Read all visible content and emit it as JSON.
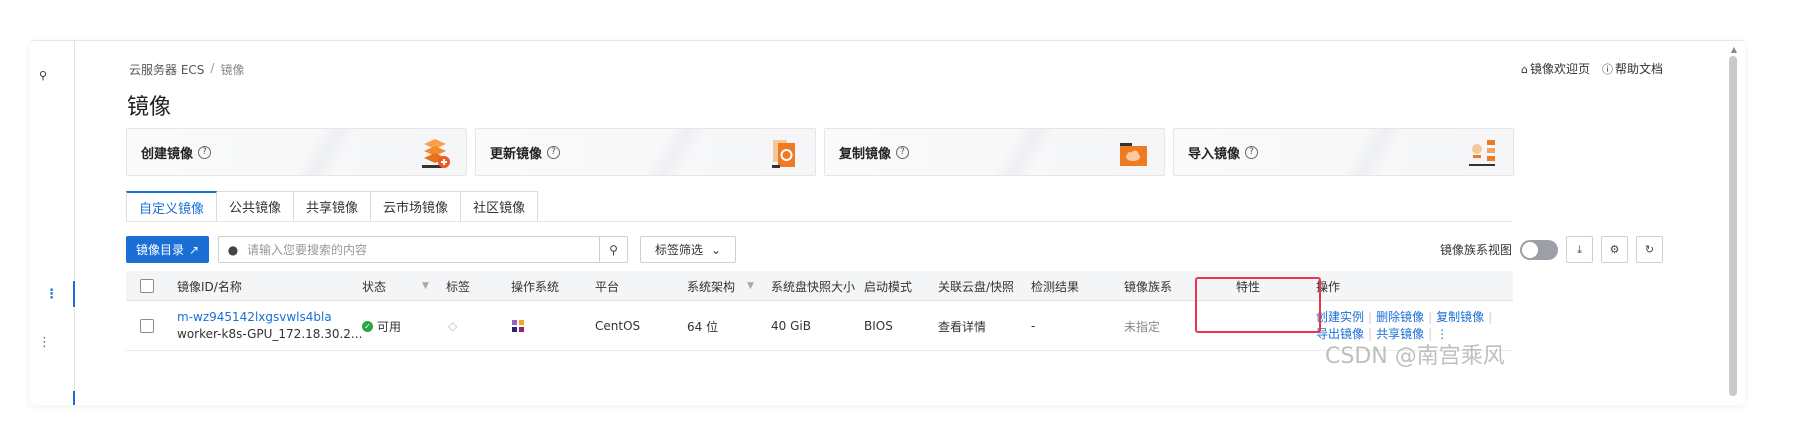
{
  "breadcrumb": {
    "root": "云服务器 ECS",
    "separator": "/",
    "current": "镜像"
  },
  "top_links": {
    "welcome": "镜像欢迎页",
    "help": "帮助文档"
  },
  "page_title": "镜像",
  "cards": [
    {
      "label": "创建镜像",
      "icon": "layers-plus-icon"
    },
    {
      "label": "更新镜像",
      "icon": "refresh-doc-icon"
    },
    {
      "label": "复制镜像",
      "icon": "folder-cloud-icon"
    },
    {
      "label": "导入镜像",
      "icon": "import-list-icon"
    }
  ],
  "tabs": [
    "自定义镜像",
    "公共镜像",
    "共享镜像",
    "云市场镜像",
    "社区镜像"
  ],
  "toolbar": {
    "catalog_button": "镜像目录",
    "search_placeholder": "请输入您要搜索的内容",
    "tag_filter": "标签筛选",
    "family_view_label": "镜像族系视图"
  },
  "table": {
    "headers": [
      "镜像ID/名称",
      "状态",
      "标签",
      "操作系统",
      "平台",
      "系统架构",
      "系统盘快照大小",
      "启动模式",
      "关联云盘/快照",
      "检测结果",
      "镜像族系",
      "特性",
      "操作"
    ],
    "row": {
      "image_id": "m-wz945142lxgsvwls4bla",
      "image_name": "worker-k8s-GPU_172.18.30.2...",
      "status": "可用",
      "platform": "CentOS",
      "arch": "64 位",
      "size": "40 GiB",
      "boot_mode": "BIOS",
      "related": "查看详情",
      "check_result": "-",
      "family": "未指定",
      "actions": {
        "create_instance": "创建实例",
        "delete_image": "删除镜像",
        "copy_image": "复制镜像",
        "export_image": "导出镜像",
        "share_image": "共享镜像"
      }
    }
  },
  "watermark": "CSDN @南宫乘风",
  "colors": {
    "accent": "#1a6fd6",
    "highlight": "#e8354d",
    "status_ok": "#27a744"
  }
}
